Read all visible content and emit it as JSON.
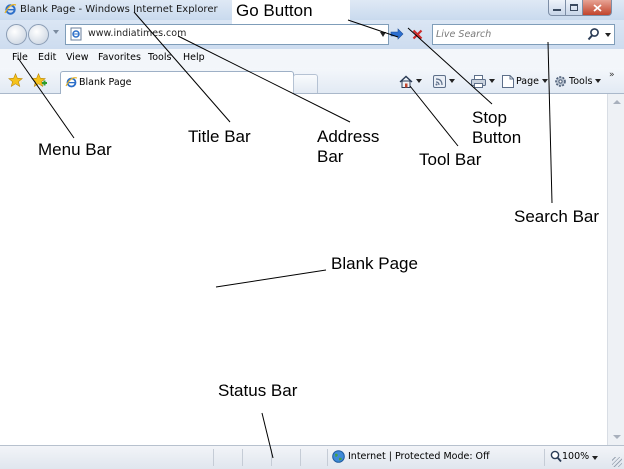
{
  "window": {
    "title": "Blank Page - Windows Internet Explorer",
    "controls": [
      "minimize",
      "maximize",
      "close"
    ]
  },
  "navigation": {
    "address": "www.indiatimes.com",
    "search_placeholder": "Live Search"
  },
  "menu": [
    "File",
    "Edit",
    "View",
    "Favorites",
    "Tools",
    "Help"
  ],
  "tab": {
    "title": "Blank Page"
  },
  "toolbar": {
    "page_label": "Page",
    "tools_label": "Tools",
    "icons": [
      "home-icon",
      "feeds-icon",
      "print-icon",
      "page-icon",
      "tools-gear-icon"
    ]
  },
  "status": {
    "zone": "Internet | Protected Mode: Off",
    "zoom": "100%"
  },
  "annotations": {
    "go_button": "Go Button",
    "menu_bar": "Menu Bar",
    "title_bar": "Title Bar",
    "address_bar": "Address\nBar",
    "stop_button": "Stop\nButton",
    "tool_bar": "Tool Bar",
    "search_bar": "Search Bar",
    "blank_page": "Blank Page",
    "status_bar": "Status Bar"
  },
  "colors": {
    "chrome": "#cddcef",
    "stop_red": "#cc2b2b",
    "go_blue": "#2c6fd1"
  }
}
